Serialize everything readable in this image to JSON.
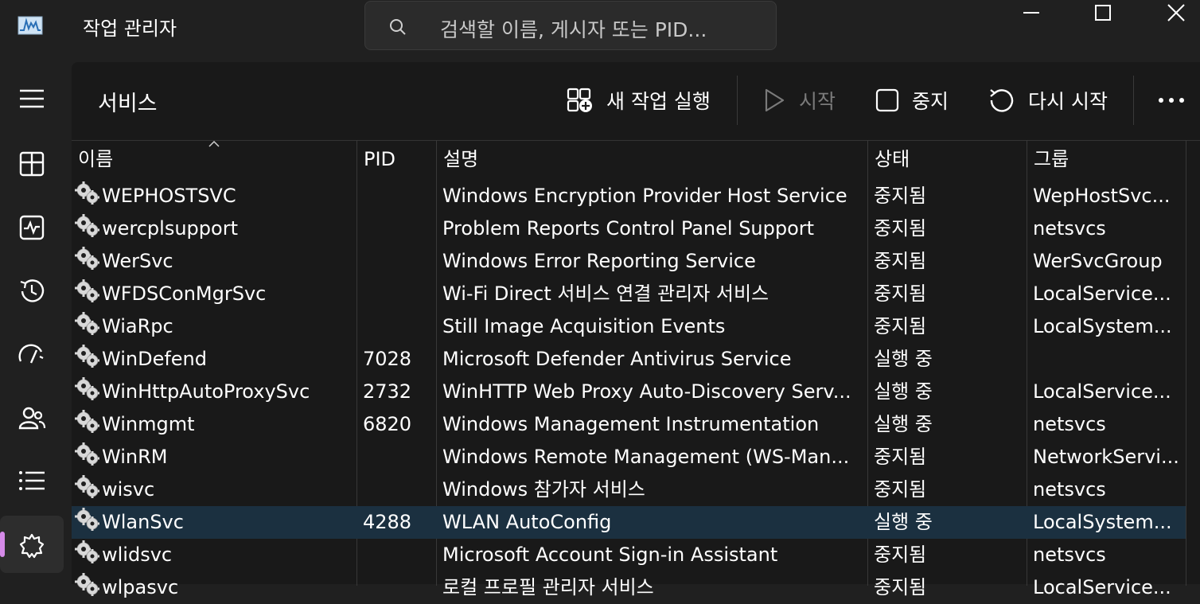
{
  "app": {
    "title": "작업 관리자"
  },
  "search": {
    "placeholder": "검색할 이름, 게시자 또는 PID..."
  },
  "page": {
    "title": "서비스"
  },
  "toolbar": {
    "new_task": "새 작업 실행",
    "start": "시작",
    "stop": "중지",
    "restart": "다시 시작"
  },
  "table": {
    "columns": [
      "이름",
      "PID",
      "설명",
      "상태",
      "그룹"
    ],
    "rows": [
      {
        "name": "WEPHOSTSVC",
        "pid": "",
        "desc": "Windows Encryption Provider Host Service",
        "status": "중지됨",
        "group": "WepHostSvc..."
      },
      {
        "name": "wercplsupport",
        "pid": "",
        "desc": "Problem Reports Control Panel Support",
        "status": "중지됨",
        "group": "netsvcs"
      },
      {
        "name": "WerSvc",
        "pid": "",
        "desc": "Windows Error Reporting Service",
        "status": "중지됨",
        "group": "WerSvcGroup"
      },
      {
        "name": "WFDSConMgrSvc",
        "pid": "",
        "desc": "Wi-Fi Direct 서비스 연결 관리자 서비스",
        "status": "중지됨",
        "group": "LocalService..."
      },
      {
        "name": "WiaRpc",
        "pid": "",
        "desc": "Still Image Acquisition Events",
        "status": "중지됨",
        "group": "LocalSystem..."
      },
      {
        "name": "WinDefend",
        "pid": "7028",
        "desc": "Microsoft Defender Antivirus Service",
        "status": "실행 중",
        "group": ""
      },
      {
        "name": "WinHttpAutoProxySvc",
        "pid": "2732",
        "desc": "WinHTTP Web Proxy Auto-Discovery Serv...",
        "status": "실행 중",
        "group": "LocalService..."
      },
      {
        "name": "Winmgmt",
        "pid": "6820",
        "desc": "Windows Management Instrumentation",
        "status": "실행 중",
        "group": "netsvcs"
      },
      {
        "name": "WinRM",
        "pid": "",
        "desc": "Windows Remote Management (WS-Man...",
        "status": "중지됨",
        "group": "NetworkServi..."
      },
      {
        "name": "wisvc",
        "pid": "",
        "desc": "Windows 참가자 서비스",
        "status": "중지됨",
        "group": "netsvcs"
      },
      {
        "name": "WlanSvc",
        "pid": "4288",
        "desc": "WLAN AutoConfig",
        "status": "실행 중",
        "group": "LocalSystem...",
        "selected": true
      },
      {
        "name": "wlidsvc",
        "pid": "",
        "desc": "Microsoft Account Sign-in Assistant",
        "status": "중지됨",
        "group": "netsvcs"
      },
      {
        "name": "wlpasvc",
        "pid": "",
        "desc": "로컬 프로필 관리자 서비스",
        "status": "중지됨",
        "group": "LocalService..."
      }
    ]
  },
  "colors": {
    "selected_row": "#1b3040",
    "active_indicator": "#d58ae8",
    "background": "#202020"
  },
  "icons": [
    "app-chart-icon",
    "search-icon",
    "minimize-icon",
    "maximize-icon",
    "close-icon",
    "hamburger-icon",
    "processes-icon",
    "performance-icon",
    "app-history-icon",
    "startup-icon",
    "users-icon",
    "details-icon",
    "services-icon",
    "new-task-icon",
    "play-icon",
    "stop-icon",
    "restart-icon",
    "more-icon",
    "gear-icon"
  ]
}
